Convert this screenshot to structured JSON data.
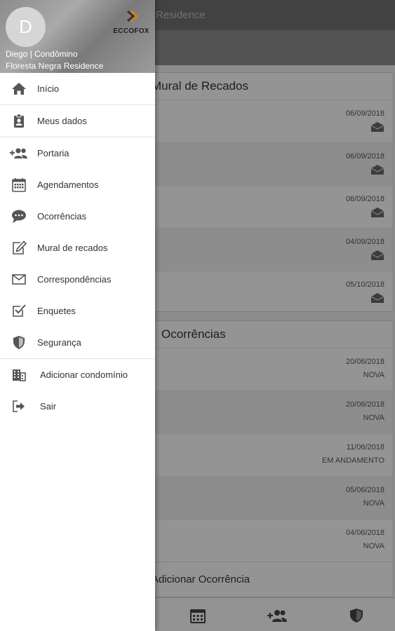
{
  "appbar": {
    "title": "Residence"
  },
  "mural": {
    "title": "Mural de Recados",
    "rows": [
      {
        "date": "06/09/2018"
      },
      {
        "date": "06/09/2018"
      },
      {
        "date": "06/09/2018"
      },
      {
        "date": "04/09/2018"
      },
      {
        "date": "05/10/2018"
      }
    ]
  },
  "ocorrencias": {
    "title": "Ocorrências",
    "rows": [
      {
        "date": "20/06/2018",
        "status": "NOVA"
      },
      {
        "date": "20/06/2018",
        "status": "NOVA"
      },
      {
        "date": "11/06/2018",
        "status": "EM ANDAMENTO"
      },
      {
        "date": "05/06/2018",
        "status": "NOVA"
      },
      {
        "date": "04/06/2018",
        "status": "NOVA"
      }
    ],
    "add_label": "Adicionar Ocorrência"
  },
  "drawer": {
    "avatar_letter": "D",
    "logo_text": "ECCOFOX",
    "user_name": "Diego | Condômino",
    "condo_name": "Floresta Negra Residence",
    "items": [
      {
        "label": "Início",
        "icon": "home-icon"
      },
      {
        "label": "Meus dados",
        "icon": "id-badge-icon"
      },
      {
        "label": "Portaria",
        "icon": "add-people-icon"
      },
      {
        "label": "Agendamentos",
        "icon": "calendar-icon"
      },
      {
        "label": "Ocorrências",
        "icon": "chat-bubble-icon"
      },
      {
        "label": "Mural de recados",
        "icon": "edit-icon"
      },
      {
        "label": "Correspondências",
        "icon": "envelope-icon"
      },
      {
        "label": "Enquetes",
        "icon": "checkbox-icon"
      },
      {
        "label": "Segurança",
        "icon": "shield-icon"
      },
      {
        "label": "Adicionar condomínio",
        "icon": "building-icon"
      },
      {
        "label": "Sair",
        "icon": "logout-icon"
      }
    ]
  },
  "colors": {
    "drawer_bg": "#ffffff",
    "scrim": "rgba(0,0,0,0.40)",
    "icon_gray": "#555555",
    "logo_accent": "#e07b1a"
  }
}
